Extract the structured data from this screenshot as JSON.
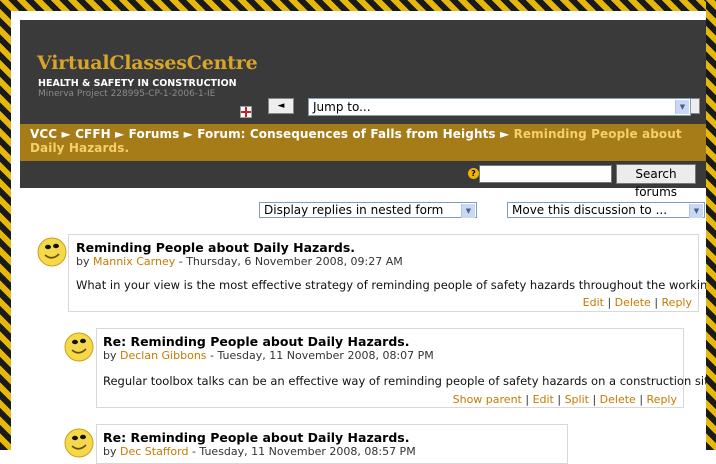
{
  "header": {
    "site_name": "VirtualClassesCentre",
    "course_name": "HEALTH & SAFETY IN CONSTRUCTION",
    "project": "Minerva Project 228995-CP-1-2006-1-IE",
    "prev_label": "◄",
    "next_label": "►",
    "jump_placeholder": "Jump to..."
  },
  "breadcrumb": {
    "items": [
      "VCC",
      "CFFH",
      "Forums",
      "Forum: Consequences of Falls from Heights"
    ],
    "separator": "►",
    "current": "Reminding People about Daily Hazards."
  },
  "search": {
    "help_label": "?",
    "button_label": "Search forums",
    "query": ""
  },
  "controls": {
    "display_mode": "Display replies in nested form",
    "move_to": "Move this discussion to ..."
  },
  "posts": [
    {
      "subject": "Reminding People about Daily Hazards.",
      "by": "by ",
      "author": "Mannix Carney",
      "date": " - Thursday, 6 November 2008, 09:27 AM",
      "body": "What in your view is the most effective strategy of reminding people of safety hazards throughout the working day?",
      "commands": [
        "Edit",
        "Delete",
        "Reply"
      ]
    },
    {
      "subject": "Re: Reminding People about Daily Hazards.",
      "by": "by ",
      "author": "Declan Gibbons",
      "date": " - Tuesday, 11 November 2008, 08:07 PM",
      "body": "Regular toolbox talks can be an effective way of reminding people of safety hazards on a construction site.",
      "commands": [
        "Show parent",
        "Edit",
        "Split",
        "Delete",
        "Reply"
      ]
    },
    {
      "subject": "Re: Reminding People about Daily Hazards.",
      "by": "by ",
      "author": "Dec Stafford",
      "date": " - Tuesday, 11 November 2008, 08:57 PM"
    }
  ],
  "colors": {
    "header_bg": "#3a3a3a",
    "breadcrumb_bg": "#a57c18",
    "brand_gold": "#d8a52a",
    "link_orange": "#c67a00",
    "stripe_black": "#1a1a1a",
    "stripe_yellow": "#e6b80c"
  },
  "icons": {
    "avatar": "smiley-face-icon",
    "help": "help-icon",
    "flag": "language-flag-icon"
  }
}
